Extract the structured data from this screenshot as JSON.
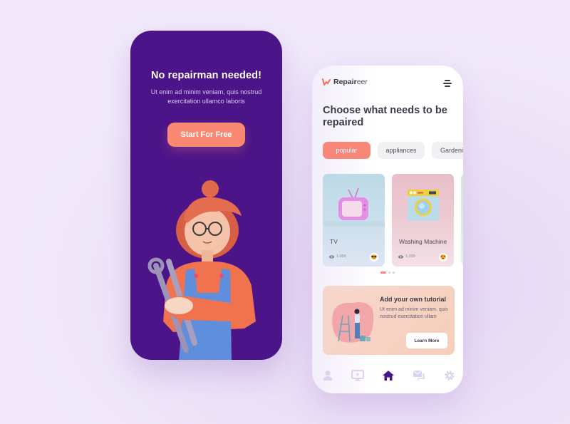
{
  "onboarding": {
    "title": "No repairman needed!",
    "subtitle": "Ut enim ad minim veniam, quis nostrud exercitation ullamco laboris",
    "cta_label": "Start For Free",
    "illustration": "woman-with-wrenches"
  },
  "app": {
    "logo_bold": "Repair",
    "logo_light": "eer",
    "menu_icon": "menu-icon",
    "heading": "Choose what needs to be repaired",
    "chips": [
      {
        "label": "popular",
        "active": true
      },
      {
        "label": "appliances",
        "active": false
      },
      {
        "label": "Gardening",
        "active": false
      }
    ],
    "cards": [
      {
        "title": "TV",
        "views": "1,056",
        "emoji": "😎",
        "icon": "tv-icon"
      },
      {
        "title": "Washing Machine",
        "views": "1,039",
        "emoji": "😍",
        "icon": "washing-machine-icon"
      }
    ],
    "carousel": {
      "pages": 3,
      "current": 1
    },
    "tutorial": {
      "title": "Add your own tutorial",
      "subtitle": "Ut enim ad minim veniam, quis nostrud exercitation ullam",
      "button_label": "Learn More"
    },
    "nav": [
      {
        "name": "profile",
        "icon": "user-icon",
        "active": false
      },
      {
        "name": "videos",
        "icon": "video-icon",
        "active": false
      },
      {
        "name": "home",
        "icon": "home-icon",
        "active": true
      },
      {
        "name": "messages",
        "icon": "chat-icon",
        "active": false
      },
      {
        "name": "settings",
        "icon": "gear-icon",
        "active": false
      }
    ]
  },
  "colors": {
    "brand_purple": "#4b1488",
    "accent_coral": "#f8877a",
    "nav_inactive": "#ddd3ee"
  }
}
